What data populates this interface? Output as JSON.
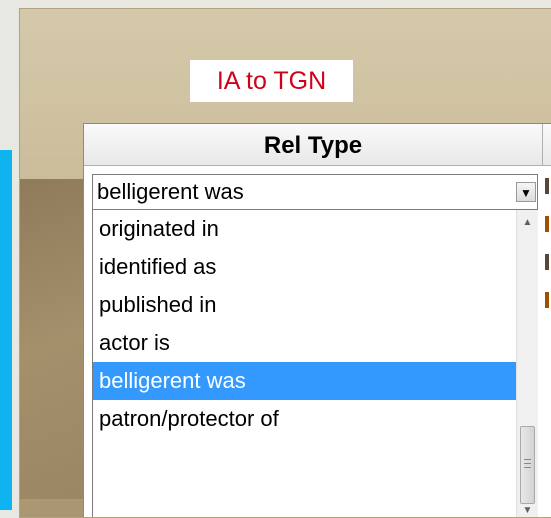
{
  "badge": {
    "title": "IA to TGN"
  },
  "grid": {
    "column_header": "Rel Type"
  },
  "combo": {
    "value": "belligerent was"
  },
  "dropdown": {
    "options": [
      "originated in",
      "identified as",
      "published in",
      "actor is",
      "belligerent was",
      "patron/protector of"
    ],
    "selected": "belligerent was"
  },
  "colors": {
    "selection": "#3399ff",
    "title_text": "#d0021b",
    "left_bar": "#0fb3f0"
  },
  "icons": {
    "combo_button": "dropdown-arrow-icon",
    "scroll_up": "scroll-up-arrow-icon",
    "scroll_down": "scroll-down-arrow-icon"
  }
}
